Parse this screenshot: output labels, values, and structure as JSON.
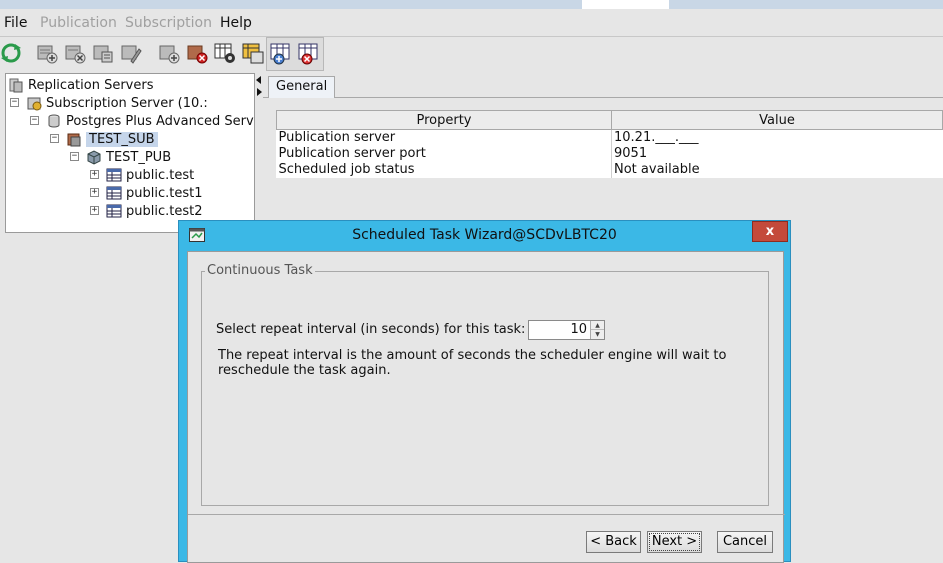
{
  "menu": {
    "file": "File",
    "publication": "Publication",
    "subscription": "Subscription",
    "help": "Help"
  },
  "toolbar": {
    "icons": [
      "refresh-icon",
      "add-server-icon",
      "remove-server-icon",
      "server-props-icon",
      "server-config-icon",
      "add-subscription-icon",
      "remove-subscription-icon",
      "schedule-icon",
      "snapshot-icon",
      "add-table-icon",
      "remove-table-icon"
    ]
  },
  "tree": {
    "root": "Replication Servers",
    "subscription_server": "Subscription Server (10.:",
    "database": "Postgres Plus Advanced Serve",
    "subscription": "TEST_SUB",
    "publication": "TEST_PUB",
    "tables": [
      "public.test",
      "public.test1",
      "public.test2"
    ]
  },
  "tab": {
    "label": "General"
  },
  "property_table": {
    "headers": [
      "Property",
      "Value"
    ],
    "rows": [
      {
        "property": "Publication server",
        "value": "10.21.___.___"
      },
      {
        "property": "Publication server port",
        "value": "9051"
      },
      {
        "property": "Scheduled job status",
        "value": "Not available"
      }
    ]
  },
  "dialog": {
    "title": "Scheduled Task Wizard@SCDvLBTC20",
    "close_label": "x",
    "group_title": "Continuous Task",
    "interval_label": "Select repeat interval (in seconds) for this task:",
    "interval_value": "10",
    "description": "The repeat interval is the amount of seconds the scheduler engine will wait to reschedule the task again.",
    "back_label": "< Back",
    "next_label": "Next >",
    "cancel_label": "Cancel"
  },
  "colors": {
    "dialog_frame": "#3bb8e6",
    "close_button": "#c44a3b",
    "selection": "#c5d5ea"
  }
}
